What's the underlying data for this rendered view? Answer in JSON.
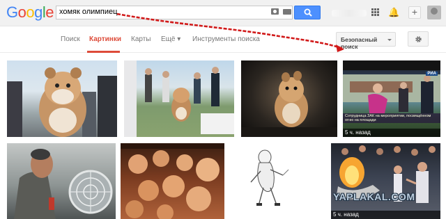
{
  "header": {
    "logo_letters": [
      {
        "ch": "G",
        "color": "#4285f4"
      },
      {
        "ch": "o",
        "color": "#ea4335"
      },
      {
        "ch": "o",
        "color": "#fbbc05"
      },
      {
        "ch": "g",
        "color": "#4285f4"
      },
      {
        "ch": "l",
        "color": "#34a853"
      },
      {
        "ch": "e",
        "color": "#ea4335"
      }
    ],
    "search_value": "хомяк олимпиец",
    "icons": [
      "camera-icon",
      "keyboard-icon",
      "search-icon",
      "apps-grid-icon",
      "bell-icon",
      "plus-icon",
      "avatar"
    ]
  },
  "nav": {
    "items": [
      {
        "label": "Поиск",
        "active": false
      },
      {
        "label": "Картинки",
        "active": true
      },
      {
        "label": "Карты",
        "active": false
      },
      {
        "label": "Ещё ▾",
        "active": false
      },
      {
        "label": "Инструменты поиска",
        "active": false
      }
    ],
    "safe_search_label": "Безопасный поиск",
    "accent_color": "#dd4b39"
  },
  "results": {
    "captions": [
      "5 ч. назад",
      "5 ч. назад"
    ],
    "news_caption": "Сотрудница ЗАК на мероприятии, посвящённом огню на площади",
    "news_logo": "РИА",
    "watermark": "YAPLAKAL.COM"
  }
}
